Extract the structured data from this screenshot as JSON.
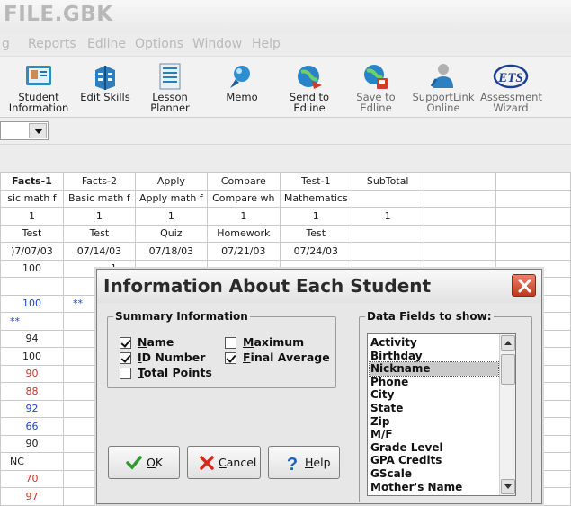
{
  "window": {
    "title": "FILE.GBK"
  },
  "menu": [
    "g",
    "Reports",
    "Edline",
    "Options",
    "Window",
    "Help"
  ],
  "toolbar": [
    {
      "label": "Student\nInformation",
      "icon": "student-information-icon"
    },
    {
      "label": "Edit Skills",
      "icon": "edit-skills-icon"
    },
    {
      "label": "Lesson\nPlanner",
      "icon": "lesson-planner-icon"
    },
    {
      "label": "Memo",
      "icon": "memo-icon"
    },
    {
      "label": "Send to\nEdline",
      "icon": "send-to-edline-icon"
    },
    {
      "label": "Save to\nEdline",
      "icon": "save-to-edline-icon"
    },
    {
      "label": "SupportLink\nOnline",
      "icon": "supportlink-online-icon"
    },
    {
      "label": "Assessment\nWizard",
      "icon": "ets-assessment-wizard-icon"
    }
  ],
  "grid": {
    "columns": [
      "Facts-1",
      "Facts-2",
      "Apply",
      "Compare",
      "Test-1",
      "SubTotal",
      "",
      ""
    ],
    "descriptions": [
      "sic math f",
      "Basic math f",
      "Apply math f",
      "Compare wh",
      "Mathematics",
      "",
      "",
      ""
    ],
    "weights": [
      "1",
      "1",
      "1",
      "1",
      "1",
      "1",
      "",
      ""
    ],
    "types": [
      "Test",
      "Test",
      "Quiz",
      "Homework",
      "Test",
      "",
      "",
      ""
    ],
    "dates": [
      ")7/07/03",
      "07/14/03",
      "07/18/03",
      "07/21/03",
      "07/24/03",
      "",
      "",
      ""
    ],
    "first_col_scores": [
      {
        "v": "100",
        "c": ""
      },
      {
        "v": "",
        "c": ""
      },
      {
        "v": "100",
        "c": "blue"
      },
      {
        "v": "**",
        "c": "blue-left"
      },
      {
        "v": "94",
        "c": ""
      },
      {
        "v": "100",
        "c": ""
      },
      {
        "v": "90",
        "c": "red"
      },
      {
        "v": "88",
        "c": "red"
      },
      {
        "v": "92",
        "c": "blue"
      },
      {
        "v": "66",
        "c": "blue"
      },
      {
        "v": "90",
        "c": ""
      },
      {
        "v": "NC",
        "c": "left"
      },
      {
        "v": "70",
        "c": "red"
      },
      {
        "v": "97",
        "c": "red"
      }
    ],
    "second_col_marks": {
      "row_top": "1",
      "row_blue": "**"
    }
  },
  "dialog": {
    "title": "Information About Each Student",
    "summary_group": "Summary Information",
    "checkboxes": [
      {
        "label": "Name",
        "checked": true
      },
      {
        "label": "ID Number",
        "checked": true
      },
      {
        "label": "Total Points",
        "checked": false
      },
      {
        "label": "Maximum",
        "checked": false
      },
      {
        "label": "Final Average",
        "checked": true
      }
    ],
    "fields_group": "Data Fields to show:",
    "fields": [
      "Activity",
      "Birthday",
      "Nickname",
      "Phone",
      "City",
      "State",
      "Zip",
      "M/F",
      "Grade Level",
      "GPA Credits",
      "GScale",
      "Mother's Name"
    ],
    "selected_field": "Nickname",
    "buttons": {
      "ok": "OK",
      "cancel": "Cancel",
      "help": "Help"
    }
  }
}
